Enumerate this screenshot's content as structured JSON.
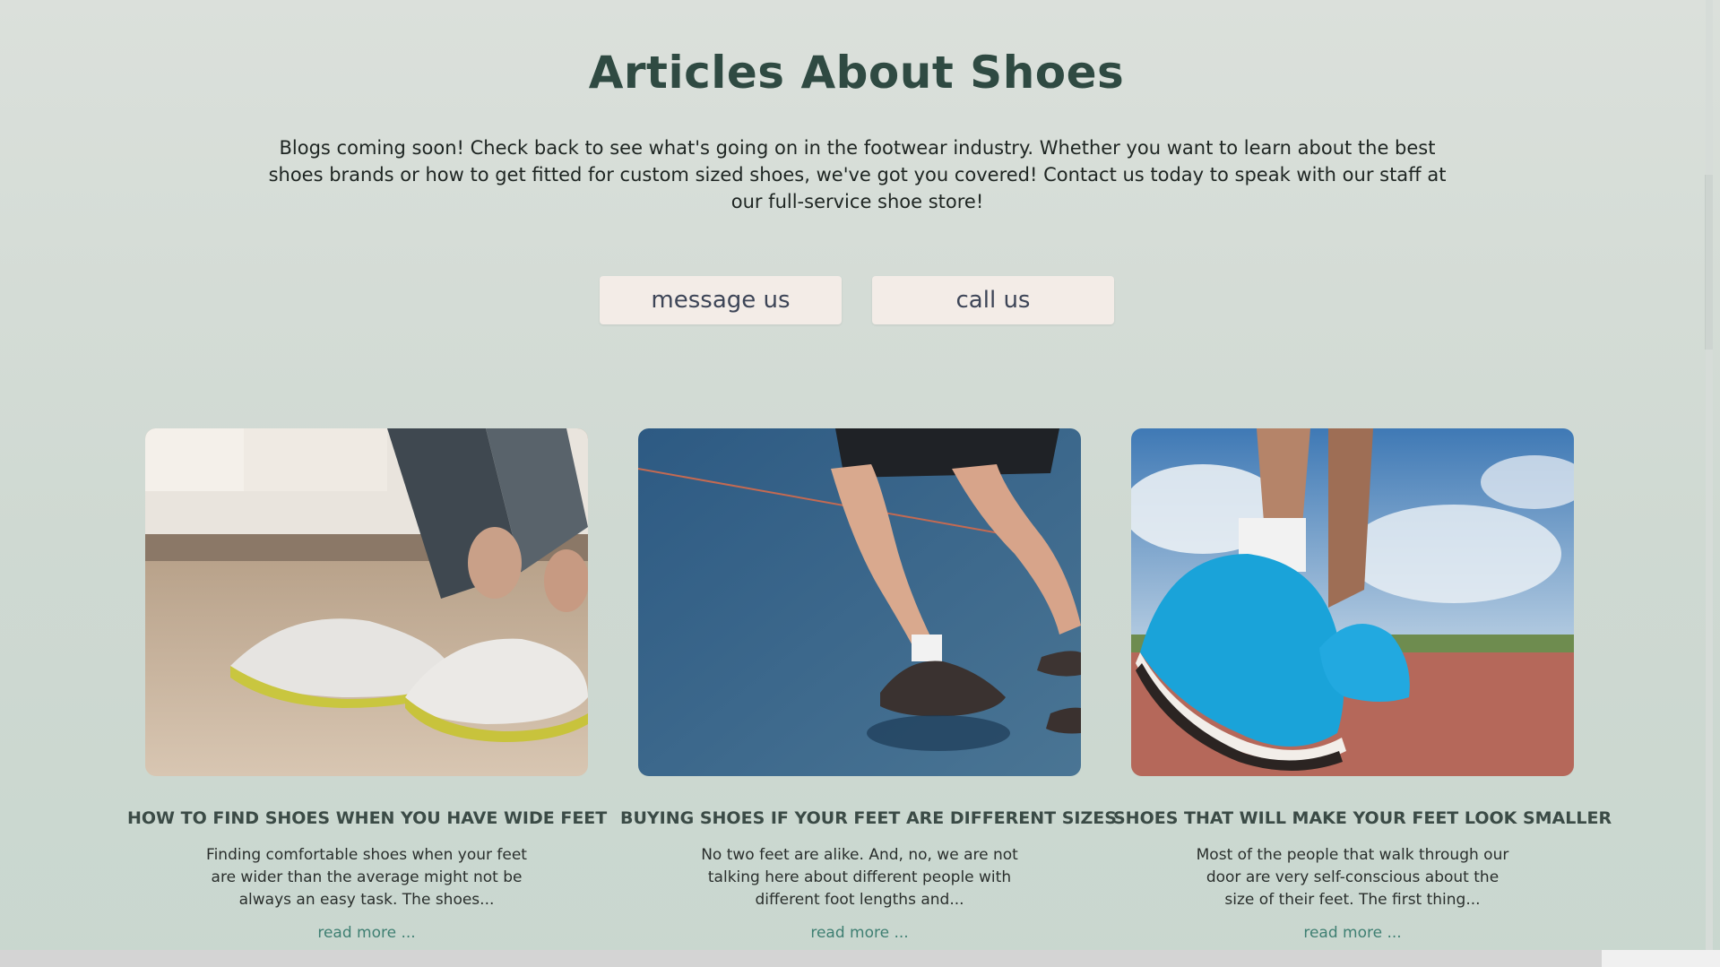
{
  "page": {
    "title": "Articles About Shoes",
    "intro": "Blogs coming soon! Check back to see what's going on in the footwear industry. Whether you want to learn about the best shoes brands or how to get fitted for custom sized shoes, we've got you covered! Contact us today to speak with our staff at our full-service shoe store!"
  },
  "buttons": {
    "message": "message us",
    "call": "call us"
  },
  "articles": [
    {
      "title": "HOW TO FIND SHOES WHEN YOU HAVE WIDE FEET",
      "excerpt": "Finding comfortable shoes when your feet are wider than the average might not be always an easy task. The shoes...",
      "link": "read more ..."
    },
    {
      "title": "BUYING SHOES IF YOUR FEET ARE DIFFERENT SIZES",
      "excerpt": "No two feet are alike. And, no, we are not talking here about different people with different foot lengths and...",
      "link": "read more ..."
    },
    {
      "title": "SHOES THAT WILL MAKE YOUR FEET LOOK SMALLER",
      "excerpt": "Most of the people that walk through our door are very self-conscious about the size of their feet. The first thing...",
      "link": "read more ..."
    }
  ],
  "colors": {
    "title": "#2f4a42",
    "button_bg": "#f3ece7",
    "link": "#3f7f72"
  }
}
